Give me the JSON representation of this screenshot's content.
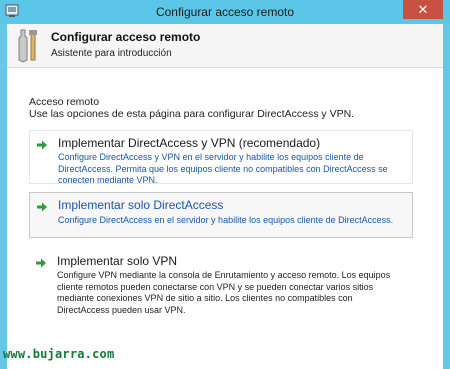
{
  "window": {
    "title": "Configurar acceso remoto",
    "close_label": "✕"
  },
  "header": {
    "title": "Configurar acceso remoto",
    "subtitle": "Asistente para introducción"
  },
  "section": {
    "label": "Acceso remoto",
    "description": "Use las opciones de esta página para configurar DirectAccess y VPN."
  },
  "options": [
    {
      "title": "Implementar DirectAccess y VPN (recomendado)",
      "description": "Configure DirectAccess y VPN en el servidor y habilite los equipos cliente de DirectAccess. Permita que los equipos cliente no compatibles con DirectAccess se conecten mediante VPN."
    },
    {
      "title": "Implementar solo DirectAccess",
      "description": "Configure DirectAccess en el servidor y habilite los equipos cliente de DirectAccess."
    },
    {
      "title": "Implementar solo VPN",
      "description": "Configure VPN mediante la consola de Enrutamiento y acceso remoto. Los equipos cliente remotos pueden conectarse con VPN y se pueden conectar varios sitios mediante conexiones VPN de sitio a sitio. Los clientes no compatibles con DirectAccess pueden usar VPN."
    }
  ],
  "watermark": "www.bujarra.com",
  "colors": {
    "frame": "#64c8e6",
    "close": "#c7503f",
    "arrow": "#2e9b3c",
    "link": "#1a56a8"
  }
}
